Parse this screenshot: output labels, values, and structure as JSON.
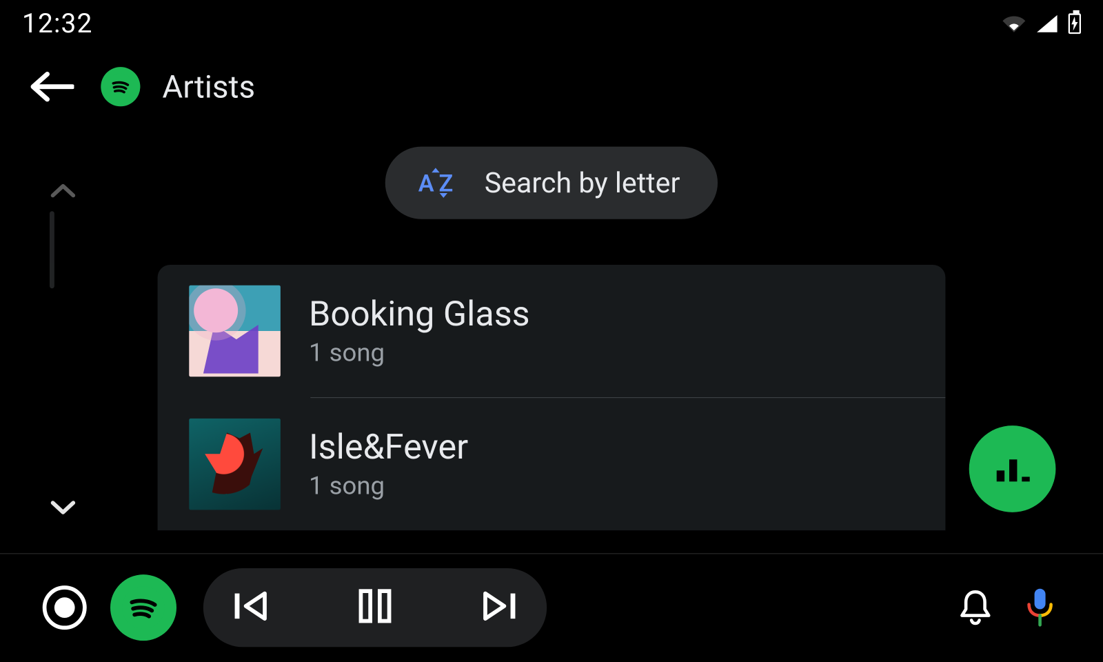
{
  "status": {
    "time": "12:32"
  },
  "header": {
    "title": "Artists"
  },
  "search_pill": {
    "icon_text": "AZ",
    "label": "Search by letter"
  },
  "artists": [
    {
      "name": "Booking Glass",
      "subtitle": "1 song"
    },
    {
      "name": "Isle&Fever",
      "subtitle": "1 song"
    }
  ],
  "colors": {
    "accent": "#1db954",
    "blue": "#5c8df6"
  }
}
